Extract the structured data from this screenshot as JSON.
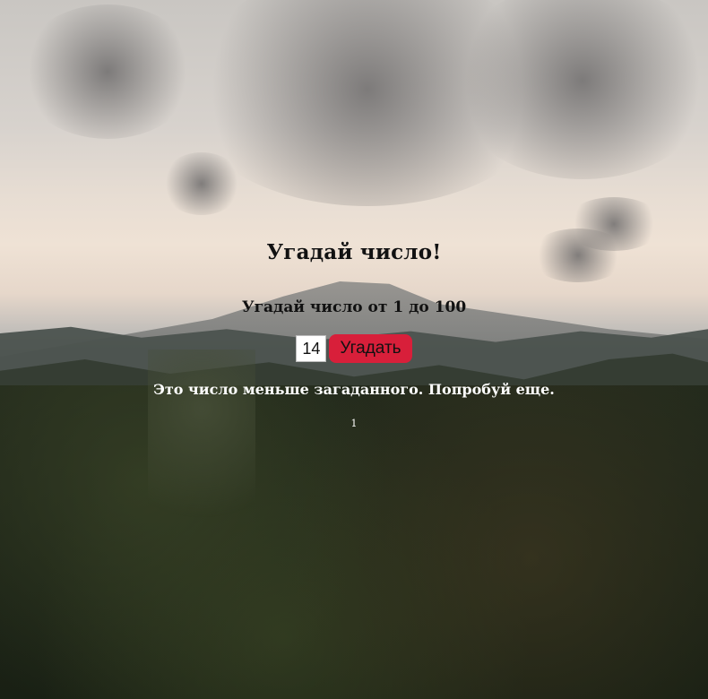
{
  "game": {
    "title": "Угадай число!",
    "instruction": "Угадай число от 1 до 100",
    "guess_value": "14",
    "guess_button_label": "Угадать",
    "feedback": "Это число меньше загаданного. Попробуй еще.",
    "attempts": "1"
  },
  "colors": {
    "button_background": "#d81f3a",
    "feedback_text": "#ffffff",
    "title_text": "#111111"
  },
  "background": {
    "scene": "mountain-landscape-image"
  }
}
